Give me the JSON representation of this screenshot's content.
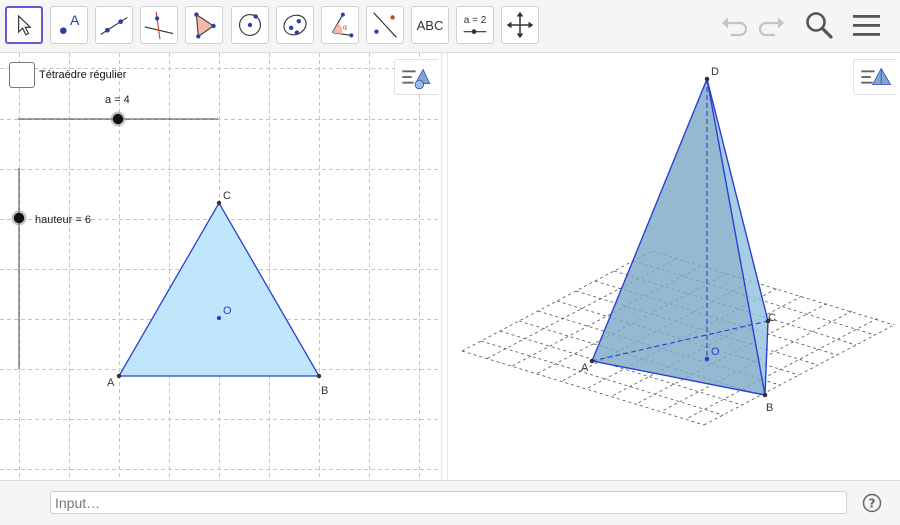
{
  "toolbar": {
    "tools": [
      {
        "name": "move",
        "text": ""
      },
      {
        "name": "point",
        "text": "A"
      },
      {
        "name": "line",
        "text": ""
      },
      {
        "name": "perpendicular-line",
        "text": ""
      },
      {
        "name": "polygon",
        "text": ""
      },
      {
        "name": "circle-center-point",
        "text": ""
      },
      {
        "name": "ellipse",
        "text": ""
      },
      {
        "name": "angle",
        "text": ""
      },
      {
        "name": "reflect",
        "text": ""
      },
      {
        "name": "text",
        "text": "ABC"
      },
      {
        "name": "slider",
        "text": "a = 2"
      },
      {
        "name": "move-graphics-view",
        "text": ""
      }
    ]
  },
  "graphics2d": {
    "checkbox_label": "Tétraèdre régulier",
    "slider_a_label": "a = 4",
    "slider_h_label": "hauteur = 6",
    "points": [
      {
        "name": "A",
        "label": "A"
      },
      {
        "name": "B",
        "label": "B"
      },
      {
        "name": "C",
        "label": "C"
      },
      {
        "name": "O",
        "label": "O"
      }
    ]
  },
  "graphics3d": {
    "points": [
      {
        "name": "A",
        "label": "A"
      },
      {
        "name": "B",
        "label": "B"
      },
      {
        "name": "C",
        "label": "C"
      },
      {
        "name": "D",
        "label": "D"
      },
      {
        "name": "O",
        "label": "O"
      }
    ]
  },
  "inputbar": {
    "placeholder": "Input…"
  },
  "colors": {
    "accent": "#6557d2",
    "triangle_fill": "#bfe6fb",
    "edge_blue": "#2b3fd4",
    "tetra_fill": "#7fa9c8"
  }
}
